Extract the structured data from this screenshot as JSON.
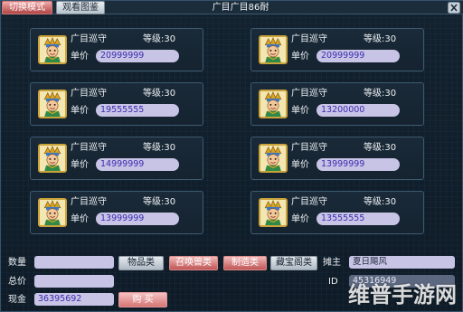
{
  "topbar": {
    "switch_mode": "切换模式",
    "view_catalog": "观看图鉴",
    "title": "广目广目86耐"
  },
  "items": [
    {
      "name": "广目巡守",
      "level": "等级:30",
      "price_label": "单价",
      "price": "20999999"
    },
    {
      "name": "广目巡守",
      "level": "等级:30",
      "price_label": "单价",
      "price": "20999999"
    },
    {
      "name": "广目巡守",
      "level": "等级:30",
      "price_label": "单价",
      "price": "19555555"
    },
    {
      "name": "广目巡守",
      "level": "等级:30",
      "price_label": "单价",
      "price": "13200000"
    },
    {
      "name": "广目巡守",
      "level": "等级:30",
      "price_label": "单价",
      "price": "14999999"
    },
    {
      "name": "广目巡守",
      "level": "等级:30",
      "price_label": "单价",
      "price": "13999999"
    },
    {
      "name": "广目巡守",
      "level": "等级:30",
      "price_label": "单价",
      "price": "13999999"
    },
    {
      "name": "广目巡守",
      "level": "等级:30",
      "price_label": "单价",
      "price": "13555555"
    }
  ],
  "bottom": {
    "quantity_label": "数量",
    "total_label": "总价",
    "cash_label": "现金",
    "cash_value": "36395692",
    "categories": [
      "物品类",
      "召唤兽类",
      "制造类",
      "藏宝阁类"
    ],
    "stall_owner_label": "摊主",
    "stall_owner_value": "夏日飓风",
    "id_label": "ID",
    "id_value": "45316949",
    "buy_label": "购 买"
  },
  "watermark": "维普手游网",
  "colors": {
    "background": "#0e1a26",
    "price_field": "#c7c4e6",
    "price_text": "#3b2cae",
    "active_button": "#b24545"
  }
}
